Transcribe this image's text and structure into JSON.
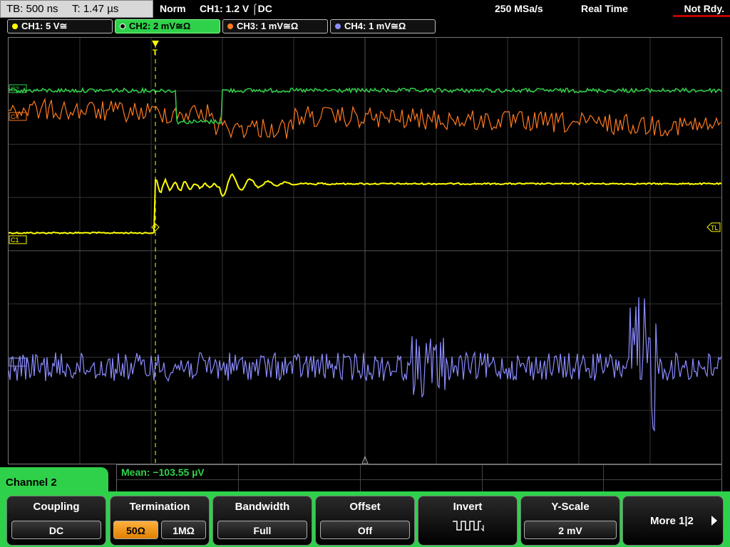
{
  "topbar": {
    "timebase": "TB: 500 ns",
    "trigger_time": "T: 1.47 µs",
    "trigger_mode": "Norm",
    "trigger_setting": "CH1: 1.2 V ⌠DC",
    "sample_rate": "250 MSa/s",
    "acq_mode": "Real Time",
    "status": "Not Rdy."
  },
  "channels": [
    {
      "label": "CH1: 5 V≅",
      "color": "#ffff00"
    },
    {
      "label": "CH2: 2 mV≅Ω",
      "color": "#2fd14a"
    },
    {
      "label": "CH3: 1 mV≅Ω",
      "color": "#ff7a20"
    },
    {
      "label": "CH4: 1 mV≅Ω",
      "color": "#8c8cff"
    }
  ],
  "markers": {
    "c2": "C2",
    "c4": "C4",
    "c1": "C1",
    "tl": "TL",
    "trig": "T"
  },
  "measurement": {
    "mean": "Mean: −103.55 µV"
  },
  "panel": {
    "title": "Channel 2"
  },
  "softkeys": {
    "coupling": {
      "title": "Coupling",
      "value": "DC"
    },
    "termination": {
      "title": "Termination",
      "opt1": "50Ω",
      "opt2": "1MΩ"
    },
    "bandwidth": {
      "title": "Bandwidth",
      "value": "Full"
    },
    "offset": {
      "title": "Offset",
      "value": "Off"
    },
    "invert": {
      "title": "Invert"
    },
    "yscale": {
      "title": "Y-Scale",
      "value": "2 mV"
    },
    "more": {
      "label": "More 1|2"
    }
  }
}
